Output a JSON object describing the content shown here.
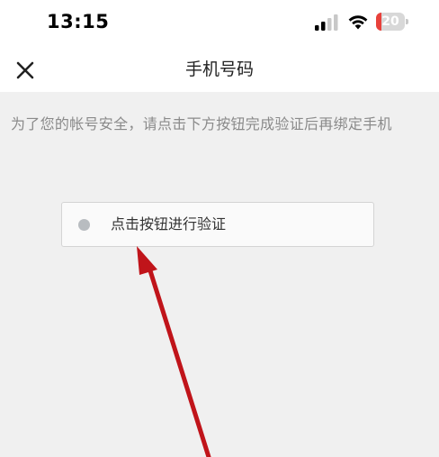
{
  "status_bar": {
    "time": "13:15",
    "battery_level": "20",
    "battery_fraction": 0.2,
    "icons": [
      "signal-icon",
      "wifi-icon",
      "battery-icon"
    ]
  },
  "nav": {
    "title": "手机号码",
    "close_icon": "close-icon"
  },
  "content": {
    "instruction": "为了您的帐号安全，请点击下方按钮完成验证后再绑定手机",
    "verify_button_label": "点击按钮进行验证"
  },
  "colors": {
    "background": "#f0f0f0",
    "surface": "#ffffff",
    "annotation_arrow": "#c0141a",
    "battery_low": "#e8413b",
    "muted_text": "#8a8a8a"
  }
}
